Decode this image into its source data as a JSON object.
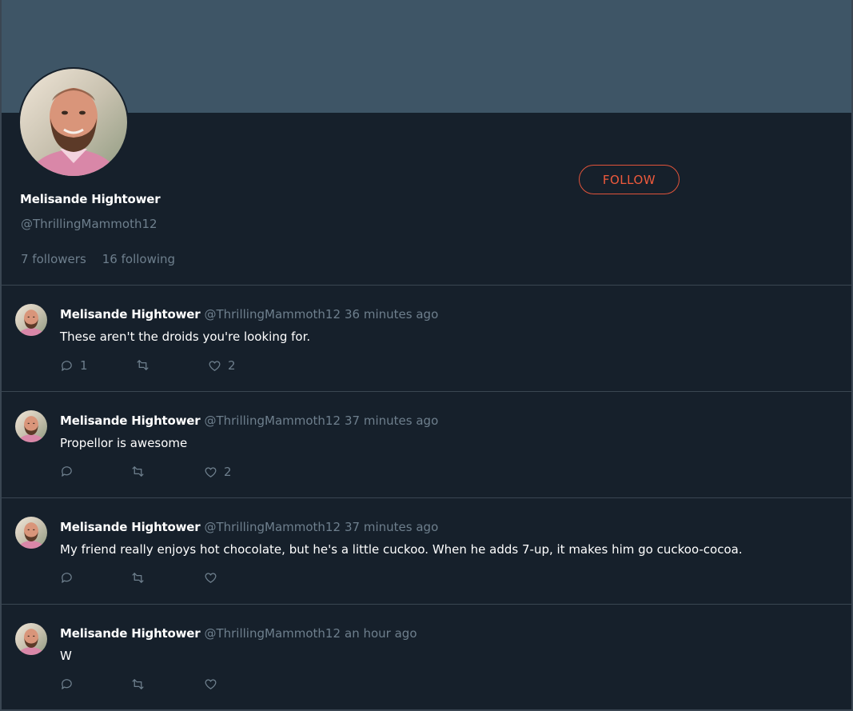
{
  "profile": {
    "name": "Melisande Hightower",
    "handle": "@ThrillingMammoth12",
    "followers": "7 followers",
    "following": "16 following",
    "follow_label": "FOLLOW"
  },
  "colors": {
    "banner": "#3e5566",
    "background": "#16202b",
    "accent": "#ef5a3c",
    "muted": "#6e7f8d",
    "divider": "#3a4652"
  },
  "tweets": [
    {
      "name": "Melisande Hightower",
      "handle": "@ThrillingMammoth12",
      "time": "36 minutes ago",
      "text": "These aren't the droids you're looking for.",
      "replies": "1",
      "retweets": "",
      "likes": "2"
    },
    {
      "name": "Melisande Hightower",
      "handle": "@ThrillingMammoth12",
      "time": "37 minutes ago",
      "text": "Propellor is awesome",
      "replies": "",
      "retweets": "",
      "likes": "2"
    },
    {
      "name": "Melisande Hightower",
      "handle": "@ThrillingMammoth12",
      "time": "37 minutes ago",
      "text": "My friend really enjoys hot chocolate, but he's a little cuckoo. When he adds 7-up, it makes him go cuckoo-cocoa.",
      "replies": "",
      "retweets": "",
      "likes": ""
    },
    {
      "name": "Melisande Hightower",
      "handle": "@ThrillingMammoth12",
      "time": "an hour ago",
      "text": "W",
      "replies": "",
      "retweets": "",
      "likes": ""
    }
  ]
}
